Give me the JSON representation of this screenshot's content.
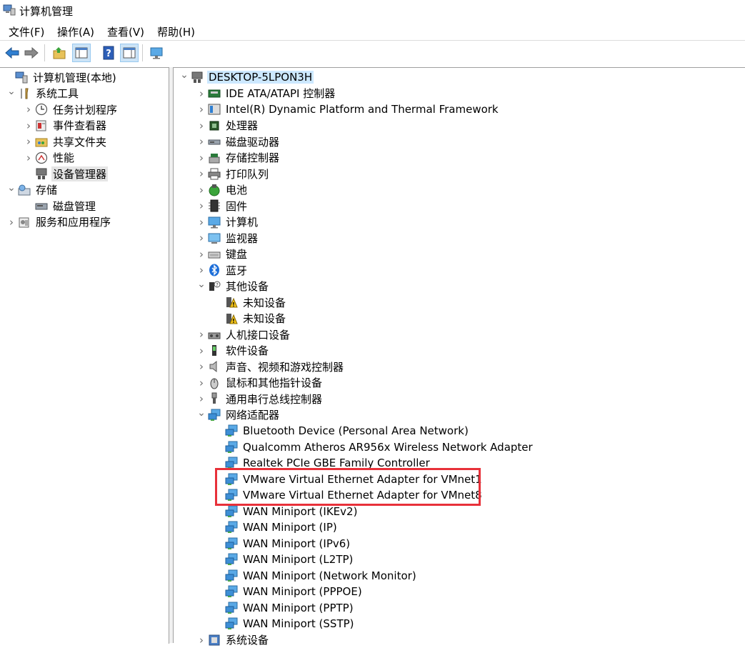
{
  "window": {
    "title": "计算机管理"
  },
  "menu": [
    "文件(F)",
    "操作(A)",
    "查看(V)",
    "帮助(H)"
  ],
  "toolbar": {
    "buttons": [
      "back-icon",
      "forward-icon",
      "up-folder-icon",
      "show-tree-icon",
      "help-icon",
      "properties-icon",
      "monitor-icon"
    ]
  },
  "left_tree": [
    {
      "label": "计算机管理(本地)",
      "icon": "computer-management-icon",
      "expanded": true
    },
    {
      "label": "系统工具",
      "icon": "tools-icon",
      "expanded": true
    },
    {
      "label": "任务计划程序",
      "icon": "clock-icon"
    },
    {
      "label": "事件查看器",
      "icon": "event-viewer-icon"
    },
    {
      "label": "共享文件夹",
      "icon": "shared-folder-icon"
    },
    {
      "label": "性能",
      "icon": "performance-icon"
    },
    {
      "label": "设备管理器",
      "icon": "device-manager-icon",
      "selected": true
    },
    {
      "label": "存储",
      "icon": "storage-icon",
      "expanded": true
    },
    {
      "label": "磁盘管理",
      "icon": "disk-icon"
    },
    {
      "label": "服务和应用程序",
      "icon": "services-icon"
    }
  ],
  "device_tree": {
    "root": "DESKTOP-5LPON3H",
    "items": [
      {
        "label": "IDE ATA/ATAPI 控制器",
        "icon": "ide-controller-icon"
      },
      {
        "label": "Intel(R) Dynamic Platform and Thermal Framework",
        "icon": "platform-icon"
      },
      {
        "label": "处理器",
        "icon": "processor-icon"
      },
      {
        "label": "磁盘驱动器",
        "icon": "disk-drive-icon"
      },
      {
        "label": "存储控制器",
        "icon": "storage-controller-icon"
      },
      {
        "label": "打印队列",
        "icon": "printer-icon"
      },
      {
        "label": "电池",
        "icon": "battery-icon"
      },
      {
        "label": "固件",
        "icon": "firmware-icon"
      },
      {
        "label": "计算机",
        "icon": "computer-icon"
      },
      {
        "label": "监视器",
        "icon": "monitor-icon"
      },
      {
        "label": "键盘",
        "icon": "keyboard-icon"
      },
      {
        "label": "蓝牙",
        "icon": "bluetooth-icon"
      },
      {
        "label": "其他设备",
        "icon": "other-devices-icon",
        "expanded": true
      },
      {
        "label": "未知设备",
        "icon": "unknown-device-icon",
        "child": true
      },
      {
        "label": "未知设备",
        "icon": "unknown-device-icon",
        "child": true
      },
      {
        "label": "人机接口设备",
        "icon": "hid-icon"
      },
      {
        "label": "软件设备",
        "icon": "software-device-icon"
      },
      {
        "label": "声音、视频和游戏控制器",
        "icon": "speaker-icon"
      },
      {
        "label": "鼠标和其他指针设备",
        "icon": "mouse-icon"
      },
      {
        "label": "通用串行总线控制器",
        "icon": "usb-icon"
      },
      {
        "label": "网络适配器",
        "icon": "network-adapter-icon",
        "expanded": true
      },
      {
        "label": "Bluetooth Device (Personal Area Network)",
        "icon": "network-adapter-icon",
        "child": true
      },
      {
        "label": "Qualcomm Atheros AR956x Wireless Network Adapter",
        "icon": "network-adapter-icon",
        "child": true
      },
      {
        "label": "Realtek PCIe GBE Family Controller",
        "icon": "network-adapter-icon",
        "child": true
      },
      {
        "label": "VMware Virtual Ethernet Adapter for VMnet1",
        "icon": "network-adapter-icon",
        "child": true
      },
      {
        "label": "VMware Virtual Ethernet Adapter for VMnet8",
        "icon": "network-adapter-icon",
        "child": true
      },
      {
        "label": "WAN Miniport (IKEv2)",
        "icon": "network-adapter-icon",
        "child": true
      },
      {
        "label": "WAN Miniport (IP)",
        "icon": "network-adapter-icon",
        "child": true
      },
      {
        "label": "WAN Miniport (IPv6)",
        "icon": "network-adapter-icon",
        "child": true
      },
      {
        "label": "WAN Miniport (L2TP)",
        "icon": "network-adapter-icon",
        "child": true
      },
      {
        "label": "WAN Miniport (Network Monitor)",
        "icon": "network-adapter-icon",
        "child": true
      },
      {
        "label": "WAN Miniport (PPPOE)",
        "icon": "network-adapter-icon",
        "child": true
      },
      {
        "label": "WAN Miniport (PPTP)",
        "icon": "network-adapter-icon",
        "child": true
      },
      {
        "label": "WAN Miniport (SSTP)",
        "icon": "network-adapter-icon",
        "child": true
      },
      {
        "label": "系统设备",
        "icon": "system-device-icon"
      }
    ]
  },
  "highlight": {
    "color": "#e8313a"
  }
}
